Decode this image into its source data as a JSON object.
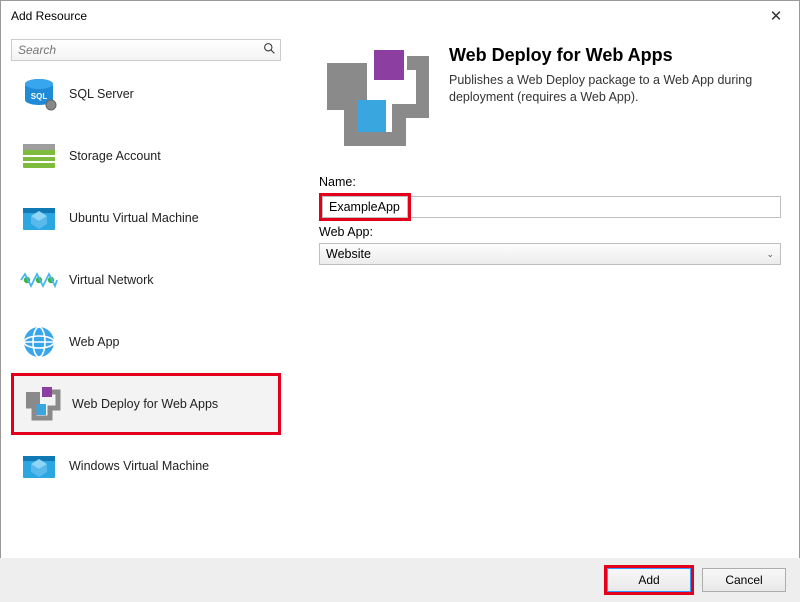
{
  "window": {
    "title": "Add Resource"
  },
  "search": {
    "placeholder": "Search"
  },
  "resources": {
    "items": [
      {
        "label": "SQL Server",
        "icon": "sql-server-icon"
      },
      {
        "label": "Storage Account",
        "icon": "storage-icon"
      },
      {
        "label": "Ubuntu Virtual Machine",
        "icon": "ubuntu-vm-icon"
      },
      {
        "label": "Virtual Network",
        "icon": "vnet-icon"
      },
      {
        "label": "Web App",
        "icon": "webapp-icon"
      },
      {
        "label": "Web Deploy for Web Apps",
        "icon": "webdeploy-icon",
        "selected": true
      },
      {
        "label": "Windows Virtual Machine",
        "icon": "windows-vm-icon"
      }
    ]
  },
  "detail": {
    "title": "Web Deploy for Web Apps",
    "description": "Publishes a Web Deploy package to a Web App during deployment (requires a Web App).",
    "name_label": "Name:",
    "name_value": "ExampleApp",
    "webapp_label": "Web App:",
    "webapp_value": "Website"
  },
  "footer": {
    "add": "Add",
    "cancel": "Cancel"
  }
}
